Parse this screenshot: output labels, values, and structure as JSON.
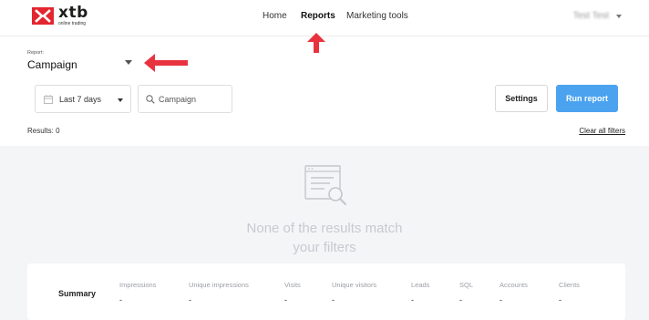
{
  "brand": {
    "name": "xtb",
    "tagline": "online trading",
    "color": "#e3262f"
  },
  "nav": {
    "items": [
      {
        "label": "Home",
        "active": false
      },
      {
        "label": "Reports",
        "active": true
      },
      {
        "label": "Marketing tools",
        "active": false
      }
    ]
  },
  "user": {
    "name": "Test Test"
  },
  "report": {
    "label": "Report:",
    "value": "Campaign"
  },
  "filters": {
    "date_range": "Last 7 days",
    "search_placeholder": "Campaign"
  },
  "actions": {
    "settings": "Settings",
    "run": "Run report"
  },
  "results": {
    "text": "Results: 0",
    "clear": "Clear all filters"
  },
  "empty": {
    "line1": "None of the results match",
    "line2": "your filters"
  },
  "summary": {
    "title": "Summary",
    "columns": [
      {
        "label": "Impressions",
        "value": "-"
      },
      {
        "label": "Unique impressions",
        "value": "-"
      },
      {
        "label": "Visits",
        "value": "-"
      },
      {
        "label": "Unique visitors",
        "value": "-"
      },
      {
        "label": "Leads",
        "value": "-"
      },
      {
        "label": "SQL",
        "value": "-"
      },
      {
        "label": "Accounts",
        "value": "-"
      },
      {
        "label": "Clients",
        "value": "-"
      }
    ]
  },
  "colors": {
    "accent": "#4ba3f0",
    "annotation_arrow": "#e8333f",
    "empty_bg": "#f4f5f7"
  }
}
